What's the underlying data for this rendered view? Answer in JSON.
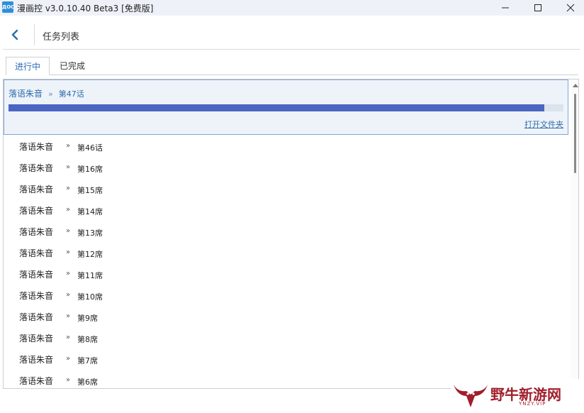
{
  "window": {
    "app_icon_text": "ДОС",
    "title": "漫画控 v3.0.10.40 Beta3 [免费版]"
  },
  "nav": {
    "title": "任务列表"
  },
  "tabs": [
    {
      "label": "进行中",
      "active": true
    },
    {
      "label": "已完成",
      "active": false
    }
  ],
  "active_task": {
    "name": "落语朱音",
    "separator": "»",
    "chapter": "第47话",
    "progress": 0.965,
    "open_folder_label": "打开文件夹"
  },
  "queue": [
    {
      "name": "落语朱音",
      "separator": "»",
      "chapter": "第46话"
    },
    {
      "name": "落语朱音",
      "separator": "»",
      "chapter": "第16席"
    },
    {
      "name": "落语朱音",
      "separator": "»",
      "chapter": "第15席"
    },
    {
      "name": "落语朱音",
      "separator": "»",
      "chapter": "第14席"
    },
    {
      "name": "落语朱音",
      "separator": "»",
      "chapter": "第13席"
    },
    {
      "name": "落语朱音",
      "separator": "»",
      "chapter": "第12席"
    },
    {
      "name": "落语朱音",
      "separator": "»",
      "chapter": "第11席"
    },
    {
      "name": "落语朱音",
      "separator": "»",
      "chapter": "第10席"
    },
    {
      "name": "落语朱音",
      "separator": "»",
      "chapter": "第9席"
    },
    {
      "name": "落语朱音",
      "separator": "»",
      "chapter": "第8席"
    },
    {
      "name": "落语朱音",
      "separator": "»",
      "chapter": "第7席"
    },
    {
      "name": "落语朱音",
      "separator": "»",
      "chapter": "第6席"
    }
  ],
  "watermark": {
    "text": "野牛新游网",
    "sub": "YNZY.VIP"
  },
  "colors": {
    "accent": "#2e6ca8",
    "progress_fill": "#4a66c2",
    "watermark": "#a01e2c"
  }
}
